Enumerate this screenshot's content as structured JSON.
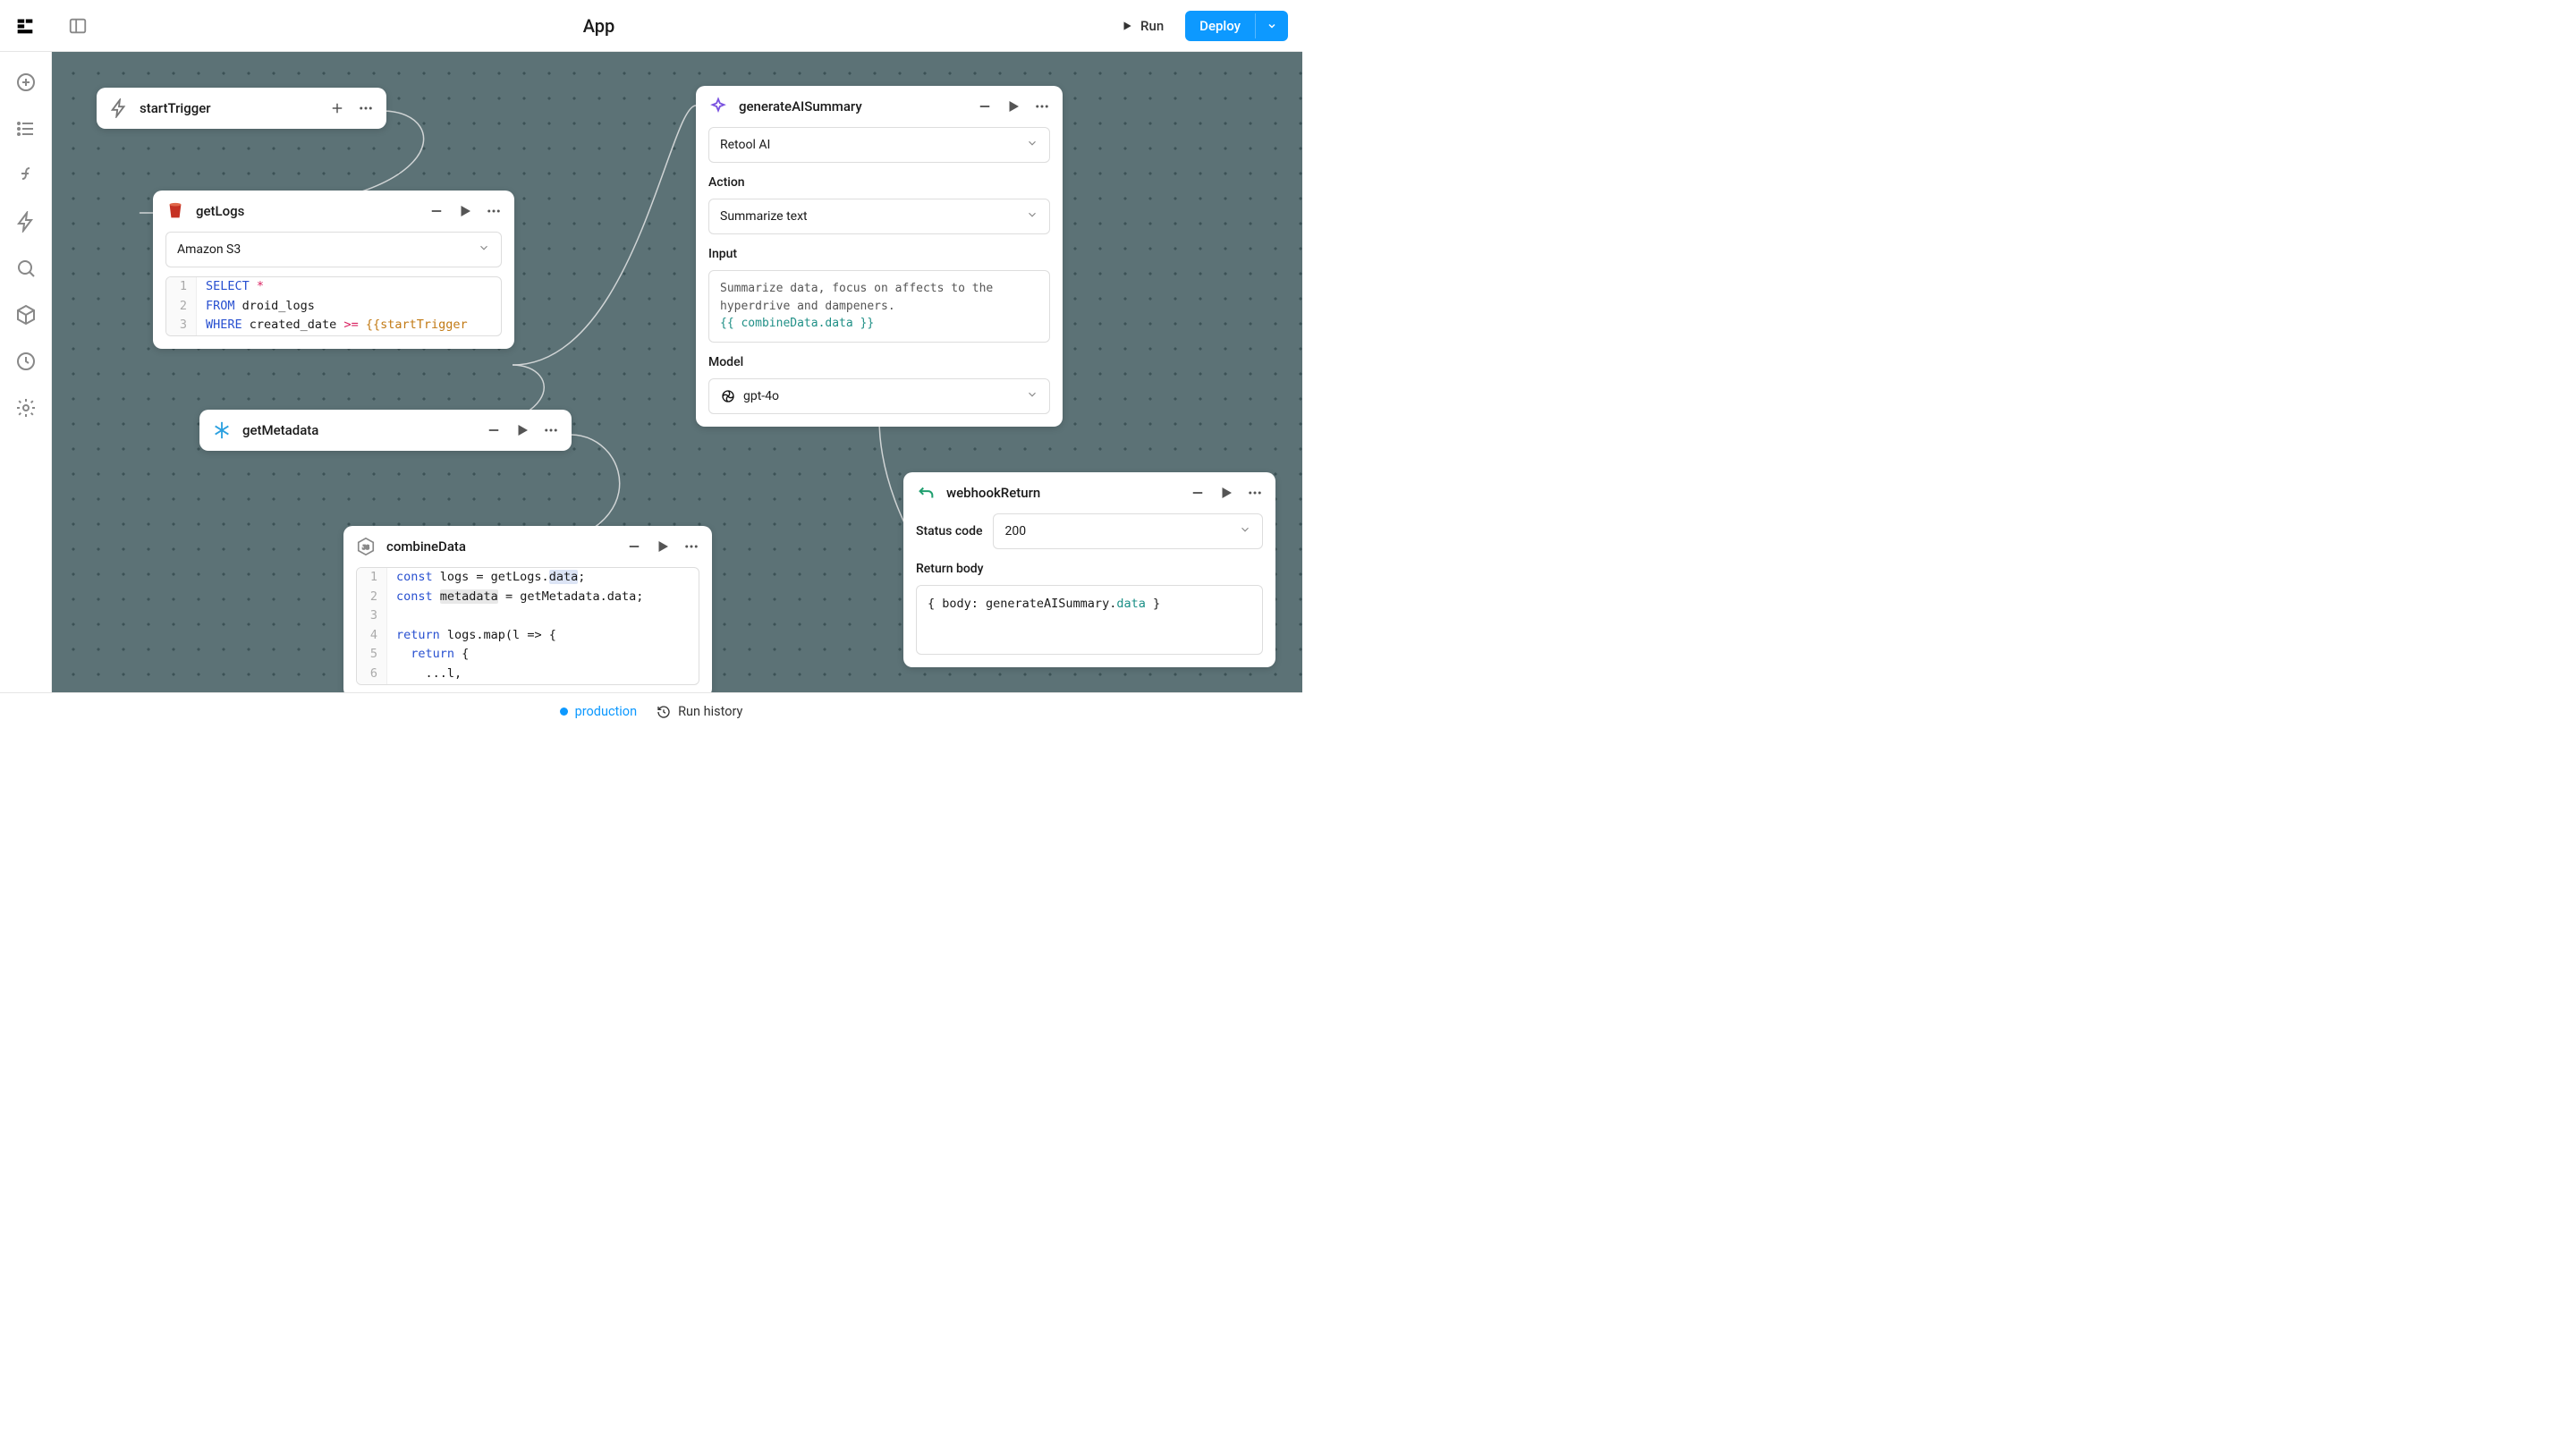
{
  "header": {
    "title": "App",
    "run_label": "Run",
    "deploy_label": "Deploy"
  },
  "nodes": {
    "startTrigger": {
      "title": "startTrigger"
    },
    "getLogs": {
      "title": "getLogs",
      "resource": "Amazon S3",
      "code": {
        "l1": {
          "kw": "SELECT",
          "rest": " *"
        },
        "l2": {
          "kw": "FROM",
          "rest": " droid_logs"
        },
        "l3": {
          "kw": "WHERE",
          "rest": " created_date ",
          "op": ">=",
          "tmpl": " {{startTrigger"
        }
      }
    },
    "getMetadata": {
      "title": "getMetadata"
    },
    "combineData": {
      "title": "combineData",
      "code": {
        "l1_kw": "const",
        "l1_rest": " logs = getLogs.",
        "l1_hl": "data",
        "l1_end": ";",
        "l2_kw": "const",
        "l2_rest": " ",
        "l2_hl": "metadata",
        "l2_rest2": " = getMetadata.data;",
        "l3": "",
        "l4_kw": "return",
        "l4_rest": " logs.map(l => {",
        "l5_kw": "  return",
        "l5_rest": " {",
        "l6": "    ...l,"
      }
    },
    "generateAISummary": {
      "title": "generateAISummary",
      "resource": "Retool AI",
      "action_label": "Action",
      "action_value": "Summarize text",
      "input_label": "Input",
      "input_text": "Summarize data, focus on affects to the hyperdrive and dampeners.",
      "input_tmpl": "{{ combineData.data }}",
      "model_label": "Model",
      "model_value": "gpt-4o"
    },
    "webhookReturn": {
      "title": "webhookReturn",
      "status_label": "Status code",
      "status_value": "200",
      "body_label": "Return body",
      "body_pre": "{ body: generateAISummary.",
      "body_prop": "data",
      "body_post": " }"
    }
  },
  "footer": {
    "env": "production",
    "runhistory": "Run history"
  }
}
